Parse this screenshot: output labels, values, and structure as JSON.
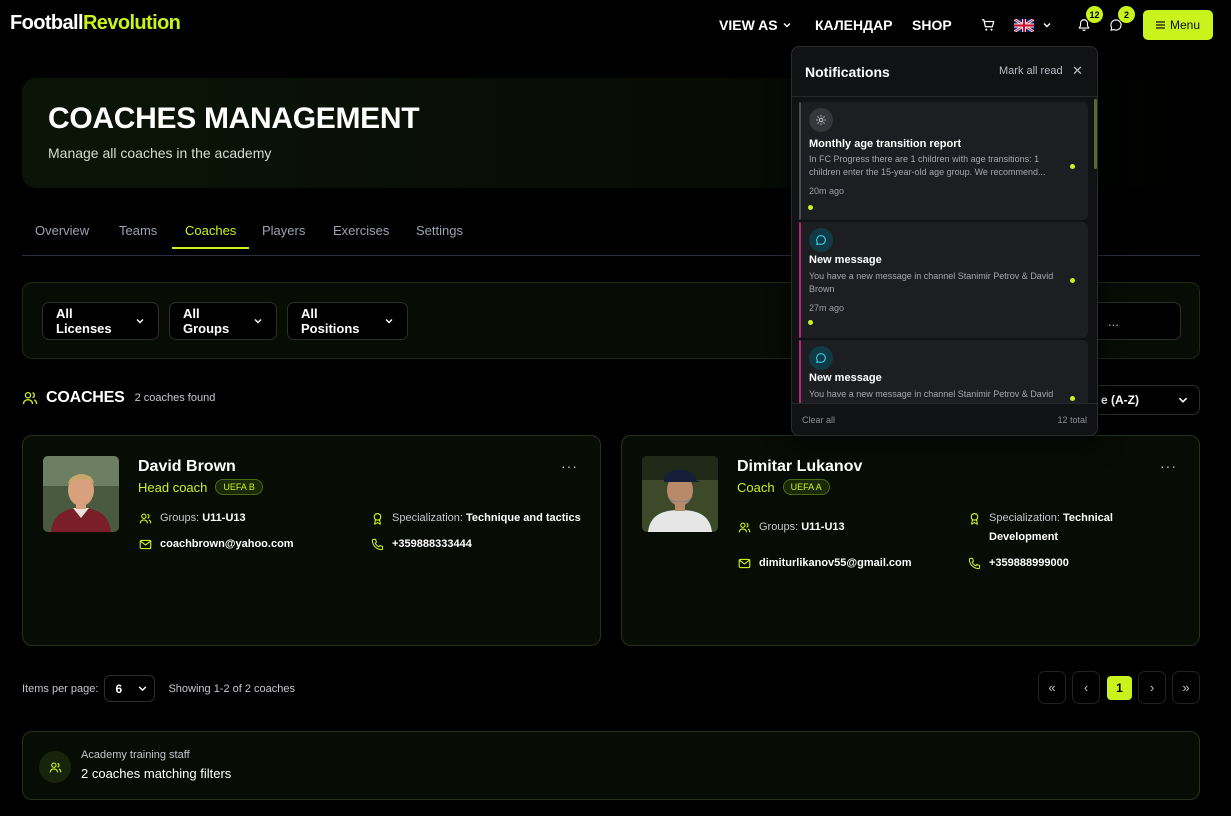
{
  "app": {
    "logo_part1": "Football",
    "logo_part2": "Revolution"
  },
  "nav": {
    "view_as": "VIEW AS",
    "calendar": "КАЛЕНДАР",
    "shop": "SHOP",
    "notifications_badge": "12",
    "messages_badge": "2",
    "menu": "Menu"
  },
  "hero": {
    "title": "COACHES MANAGEMENT",
    "subtitle": "Manage all coaches in the academy"
  },
  "tabs": [
    {
      "label": "Overview"
    },
    {
      "label": "Teams"
    },
    {
      "label": "Coaches",
      "active": true
    },
    {
      "label": "Players"
    },
    {
      "label": "Exercises"
    },
    {
      "label": "Settings"
    }
  ],
  "filters": {
    "licenses": "All Licenses",
    "groups": "All Groups",
    "positions": "All Positions",
    "search_placeholder": "..."
  },
  "section": {
    "title": "COACHES",
    "count": "2 coaches found",
    "sort": "e (A-Z)"
  },
  "coaches": [
    {
      "name": "David Brown",
      "role": "Head coach",
      "license": "UEFA B",
      "groups_label": "Groups:",
      "groups": "U11-U13",
      "email": "coachbrown@yahoo.com",
      "specialization_label": "Specialization:",
      "specialization": "Technique and tactics",
      "phone": "+359888333444"
    },
    {
      "name": "Dimitar Lukanov",
      "role": "Coach",
      "license": "UEFA A",
      "groups_label": "Groups:",
      "groups": "U11-U13",
      "email": "dimiturlikanov55@gmail.com",
      "specialization_label": "Specialization:",
      "specialization_line1": "Technical",
      "specialization_line2": "Development",
      "phone": "+359888999000"
    }
  ],
  "pagination": {
    "items_per_page_label": "Items per page:",
    "items_per_page": "6",
    "showing": "Showing 1-2 of 2 coaches",
    "first": "«",
    "prev": "‹",
    "current": "1",
    "next": "›",
    "last": "»"
  },
  "footer_card": {
    "label": "Academy training staff",
    "value": "2 coaches matching filters"
  },
  "notifications": {
    "title": "Notifications",
    "mark_all": "Mark all read",
    "close": "✕",
    "items": [
      {
        "icon": "gear-icon",
        "title": "Monthly age transition report",
        "body": "In FC Progress there are 1 children with age transitions: 1 children enter the 15-year-old age group. We recommend...",
        "time": "20m ago",
        "accent": "#8a8f98"
      },
      {
        "icon": "message-icon",
        "title": "New message",
        "body": "You have a new message in channel Stanimir Petrov & David Brown",
        "time": "27m ago",
        "accent": "#b8267a"
      },
      {
        "icon": "message-icon",
        "title": "New message",
        "body": "You have a new message in channel Stanimir Petrov & David Brown",
        "time": "",
        "accent": "#b8267a"
      }
    ],
    "clear_all": "Clear all",
    "total": "12 total"
  },
  "colors": {
    "accent": "#c8f31d",
    "background": "#000000",
    "card": "#070c04"
  }
}
